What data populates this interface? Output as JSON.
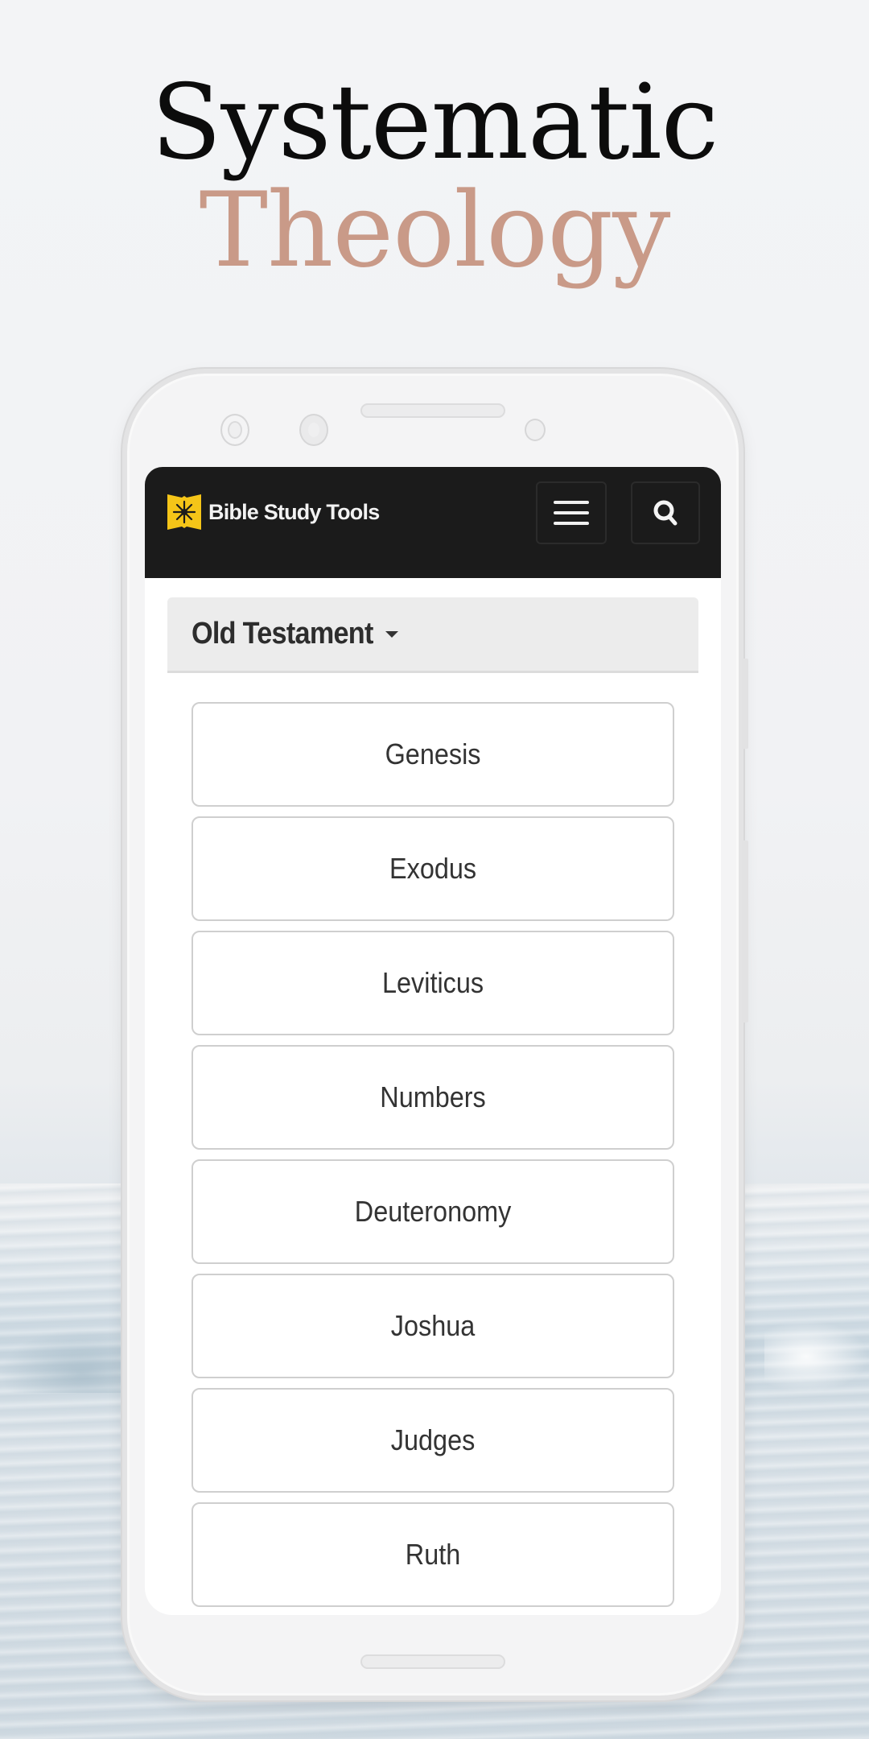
{
  "promo": {
    "title_line1": "Systematic",
    "title_line2": "Theology",
    "accent_color": "#c99a88"
  },
  "app": {
    "brand": "Bible Study Tools",
    "brand_color": "#f5c518",
    "navbar_color": "#1b1b1b",
    "icons": {
      "logo": "book-star-icon",
      "menu": "hamburger-menu-icon",
      "search": "search-icon"
    }
  },
  "testament_selector": {
    "label": "Old Testament",
    "icon": "caret-down-icon"
  },
  "books": [
    {
      "label": "Genesis"
    },
    {
      "label": "Exodus"
    },
    {
      "label": "Leviticus"
    },
    {
      "label": "Numbers"
    },
    {
      "label": "Deuteronomy"
    },
    {
      "label": "Joshua"
    },
    {
      "label": "Judges"
    },
    {
      "label": "Ruth"
    }
  ]
}
